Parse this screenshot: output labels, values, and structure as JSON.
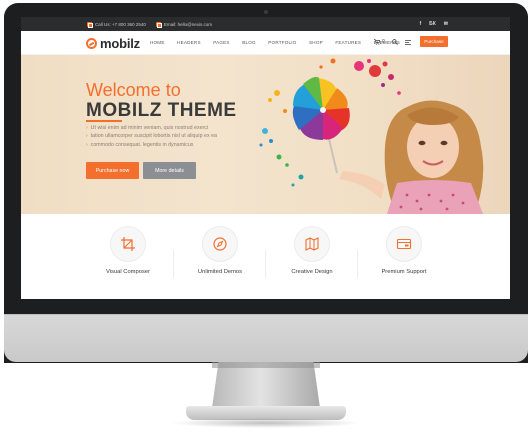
{
  "topbar": {
    "phone": "Call Us: +7 800 360 2540",
    "email": "Email: hello@nexis.com",
    "social": [
      "f",
      "БК",
      "✉"
    ]
  },
  "nav": {
    "logo_text": "mobilz",
    "menu": [
      "HOME",
      "HEADERS",
      "PAGES",
      "BLOG",
      "PORTFOLIO",
      "SHOP",
      "FEATURES",
      "ELEMENTS"
    ],
    "cart_count": "0",
    "purchase_label": "Purchase"
  },
  "hero": {
    "welcome": "Welcome to",
    "title": "MOBILZ THEME",
    "bullets": [
      "Ut wisi enim ad minim veniam, quis nostrud exerci",
      "tation ullamcorper suscipit lobortis nisl ut aliquip ex ea",
      "commodo consequat. legentis in dynamicus"
    ],
    "btn_purchase": "Purchase now",
    "btn_more": "More details"
  },
  "features": [
    {
      "label": "Visual Composer",
      "icon": "crop-icon"
    },
    {
      "label": "Unlimited Demos",
      "icon": "compass-icon"
    },
    {
      "label": "Creative Design",
      "icon": "map-icon"
    },
    {
      "label": "Premium Support",
      "icon": "card-icon"
    }
  ],
  "colors": {
    "accent": "#f36f2d",
    "topbar_bg": "#2b2c2e",
    "hero_bg": "#f2e1c9",
    "secondary_button": "#8b8f93"
  }
}
